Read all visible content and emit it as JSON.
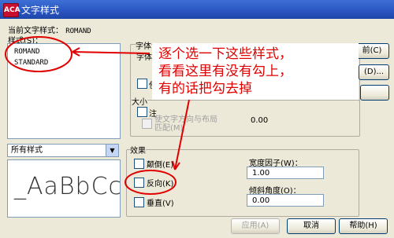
{
  "window": {
    "title": "文字样式",
    "logo": "ACA"
  },
  "current_style": {
    "label": "当前文字样式：",
    "value": "ROMAND"
  },
  "styles": {
    "label": "样式(S)：",
    "items": [
      "ROMAND",
      "STANDARD"
    ]
  },
  "filter": {
    "value": "所有样式"
  },
  "preview": {
    "text": "_AaBbCc"
  },
  "font": {
    "label": "字体",
    "sublabel": "字体",
    "checkbox_label": "使"
  },
  "size": {
    "label": "大小",
    "checkbox_partial": "注",
    "match_orientation_label": "使文字方向与布局\n匹配(M)",
    "height_value": "0.00"
  },
  "effects": {
    "label": "效果",
    "upside_down": "颠倒(E)",
    "backwards": "反向(K)",
    "vertical": "垂直(V)",
    "width_factor_label": "宽度因子(W)：",
    "width_factor_value": "1.00",
    "oblique_label": "倾斜角度(O)：",
    "oblique_value": "0.00"
  },
  "right_buttons": {
    "new_partial": "前(C)",
    "second_partial": "(D)..."
  },
  "buttons": {
    "apply": "应用(A)",
    "cancel": "取消",
    "help": "帮助(H)"
  },
  "annotation": {
    "lines": [
      "逐个选一下这些样式，",
      "看看这里有没有勾上，",
      "有的话把勾去掉"
    ],
    "color": "#e00000"
  }
}
